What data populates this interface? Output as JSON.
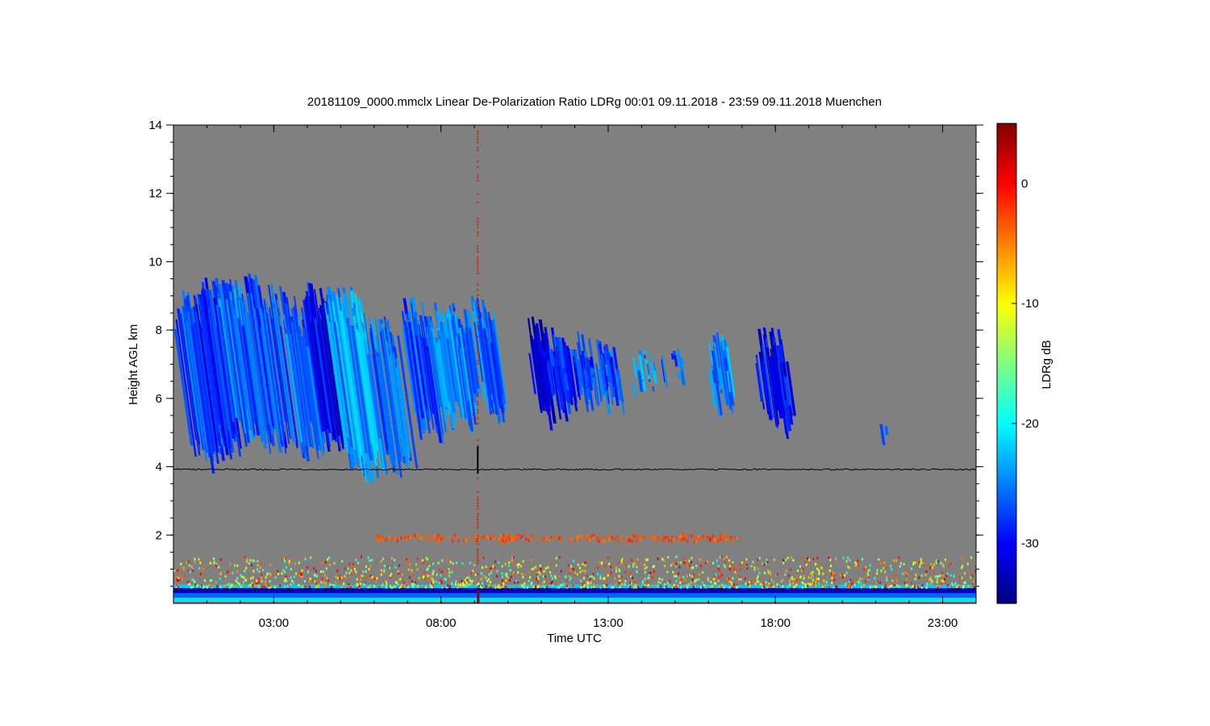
{
  "chart_data": {
    "type": "heatmap",
    "title": "20181109_0000.mmclx Linear De-Polarization Ratio LDRg   00:01 09.11.2018 - 23:59 09.11.2018 Muenchen",
    "xlabel": "Time UTC",
    "ylabel": "Height AGL km",
    "colorbar_label": "LDRg dB",
    "xlim": [
      0.0,
      24.0
    ],
    "ylim": [
      0.0,
      14.0
    ],
    "x_ticks": [
      {
        "value": 3,
        "label": "03:00"
      },
      {
        "value": 8,
        "label": "08:00"
      },
      {
        "value": 13,
        "label": "13:00"
      },
      {
        "value": 18,
        "label": "18:00"
      },
      {
        "value": 23,
        "label": "23:00"
      }
    ],
    "y_ticks": [
      {
        "value": 2,
        "label": "2"
      },
      {
        "value": 4,
        "label": "4"
      },
      {
        "value": 6,
        "label": "6"
      },
      {
        "value": 8,
        "label": "8"
      },
      {
        "value": 10,
        "label": "10"
      },
      {
        "value": 12,
        "label": "12"
      },
      {
        "value": 14,
        "label": "14"
      }
    ],
    "colorbar_range": [
      -35,
      5
    ],
    "colorbar_ticks": [
      {
        "value": 0,
        "label": "0"
      },
      {
        "value": -10,
        "label": "-10"
      },
      {
        "value": -20,
        "label": "-20"
      },
      {
        "value": -30,
        "label": "-30"
      }
    ],
    "colormap": "jet",
    "background_color": "#808080",
    "reference_line": {
      "height_km": 3.92,
      "color": "#000000"
    },
    "spike": {
      "time_utc": 9.1,
      "color": "#cc2200"
    },
    "cloud_streaks": [
      {
        "t0": 0.05,
        "t1": 1.0,
        "top": 9.2,
        "base": 4.0,
        "ldr": -27
      },
      {
        "t0": 0.7,
        "t1": 1.4,
        "top": 9.6,
        "base": 4.3,
        "ldr": -29
      },
      {
        "t0": 1.3,
        "t1": 2.1,
        "top": 9.6,
        "base": 4.6,
        "ldr": -26
      },
      {
        "t0": 2.1,
        "t1": 2.6,
        "top": 9.7,
        "base": 4.6,
        "ldr": -28
      },
      {
        "t0": 2.6,
        "t1": 3.4,
        "top": 9.4,
        "base": 4.4,
        "ldr": -27
      },
      {
        "t0": 3.3,
        "t1": 4.1,
        "top": 9.0,
        "base": 4.2,
        "ldr": -26
      },
      {
        "t0": 3.9,
        "t1": 4.7,
        "top": 9.4,
        "base": 4.4,
        "ldr": -30
      },
      {
        "t0": 4.5,
        "t1": 5.8,
        "top": 9.3,
        "base": 3.7,
        "ldr": -24
      },
      {
        "t0": 5.8,
        "t1": 6.7,
        "top": 8.4,
        "base": 3.8,
        "ldr": -26
      },
      {
        "t0": 6.8,
        "t1": 7.6,
        "top": 9.0,
        "base": 4.8,
        "ldr": -27
      },
      {
        "t0": 7.6,
        "t1": 8.6,
        "top": 8.8,
        "base": 5.2,
        "ldr": -25
      },
      {
        "t0": 8.6,
        "t1": 9.6,
        "top": 9.0,
        "base": 5.4,
        "ldr": -26
      },
      {
        "t0": 10.6,
        "t1": 11.1,
        "top": 8.5,
        "base": 5.3,
        "ldr": -32
      },
      {
        "t0": 11.1,
        "t1": 11.8,
        "top": 8.1,
        "base": 5.5,
        "ldr": -29
      },
      {
        "t0": 11.9,
        "t1": 12.5,
        "top": 8.0,
        "base": 5.8,
        "ldr": -28
      },
      {
        "t0": 12.5,
        "t1": 13.3,
        "top": 7.8,
        "base": 5.7,
        "ldr": -27
      },
      {
        "t0": 13.7,
        "t1": 14.4,
        "top": 7.5,
        "base": 6.2,
        "ldr": -25
      },
      {
        "t0": 14.6,
        "t1": 15.3,
        "top": 7.6,
        "base": 6.5,
        "ldr": -27
      },
      {
        "t0": 16.0,
        "t1": 16.6,
        "top": 8.0,
        "base": 5.4,
        "ldr": -25
      },
      {
        "t0": 17.4,
        "t1": 18.3,
        "top": 8.1,
        "base": 5.0,
        "ldr": -30
      },
      {
        "t0": 21.1,
        "t1": 21.3,
        "top": 5.4,
        "base": 4.7,
        "ldr": -26
      }
    ],
    "melting_layer_band": {
      "height_km": 1.95,
      "t0": 6.0,
      "t1": 16.9,
      "ldr": -3
    },
    "boundary_layer": {
      "top_km": 1.4,
      "bands": [
        {
          "h0": 0.05,
          "h1": 0.17,
          "ldr": -21
        },
        {
          "h0": 0.17,
          "h1": 0.3,
          "ldr": -26
        },
        {
          "h0": 0.3,
          "h1": 0.45,
          "ldr": -33
        },
        {
          "h0": 0.45,
          "h1": 0.55,
          "ldr": -22
        }
      ]
    }
  }
}
